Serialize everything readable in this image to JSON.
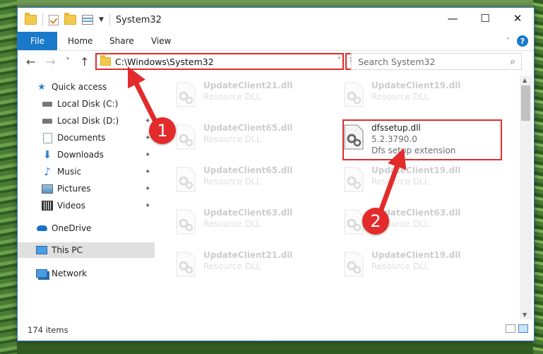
{
  "window": {
    "title": "System32",
    "controls": [
      "—",
      "☐",
      "✕"
    ]
  },
  "ribbon": {
    "file_tab": "File",
    "tabs": [
      "Home",
      "Share",
      "View"
    ],
    "help_icon": "?"
  },
  "nav": {
    "back_icon": "←",
    "forward_icon": "→",
    "recent_icon": "˅",
    "up_icon": "↑",
    "address": "C:\\Windows\\System32",
    "refresh_icon": "↻",
    "search_placeholder": "Search System32",
    "search_icon": "⌕"
  },
  "sidebar": {
    "items": [
      {
        "label": "Quick access",
        "icon": "star-icon"
      },
      {
        "label": "Local Disk (C:)",
        "icon": "drive-icon"
      },
      {
        "label": "Local Disk (D:)",
        "icon": "drive-icon"
      },
      {
        "label": "Documents",
        "icon": "documents-icon"
      },
      {
        "label": "Downloads",
        "icon": "downloads-icon"
      },
      {
        "label": "Music",
        "icon": "music-icon"
      },
      {
        "label": "Pictures",
        "icon": "pictures-icon"
      },
      {
        "label": "Videos",
        "icon": "videos-icon"
      },
      {
        "label": "OneDrive",
        "icon": "cloud-icon"
      },
      {
        "label": "This PC",
        "icon": "computer-icon"
      },
      {
        "label": "Network",
        "icon": "network-icon"
      }
    ]
  },
  "files": {
    "left_column": [
      {
        "name": "UpdateClient21.dll",
        "desc": "Resource DLL"
      },
      {
        "name": "UpdateClient65.dll",
        "desc": "Resource DLL"
      },
      {
        "name": "UpdateClient65.dll",
        "desc": "Resource DLL"
      },
      {
        "name": "UpdateClient63.dll",
        "desc": "Resource DLL"
      },
      {
        "name": "UpdateClient21.dll",
        "desc": "Resource DLL"
      }
    ],
    "right_column": [
      {
        "name": "UpdateClient19.dll",
        "desc": "Resource DLL"
      },
      {
        "name": "UpdateClient19.dll",
        "desc": "Resource DLL"
      },
      {
        "name": "UpdateClient63.dll",
        "desc": "Resource DLL"
      },
      {
        "name": "UpdateClient19.dll",
        "desc": "Resource DLL"
      }
    ],
    "highlighted": {
      "name": "dfssetup.dll",
      "version": "5.2.3790.0",
      "desc": "Dfs setup extension"
    }
  },
  "status": {
    "item_count": "174 items"
  },
  "annotations": {
    "step1": "1",
    "step2": "2",
    "color": "#e32b2b"
  }
}
